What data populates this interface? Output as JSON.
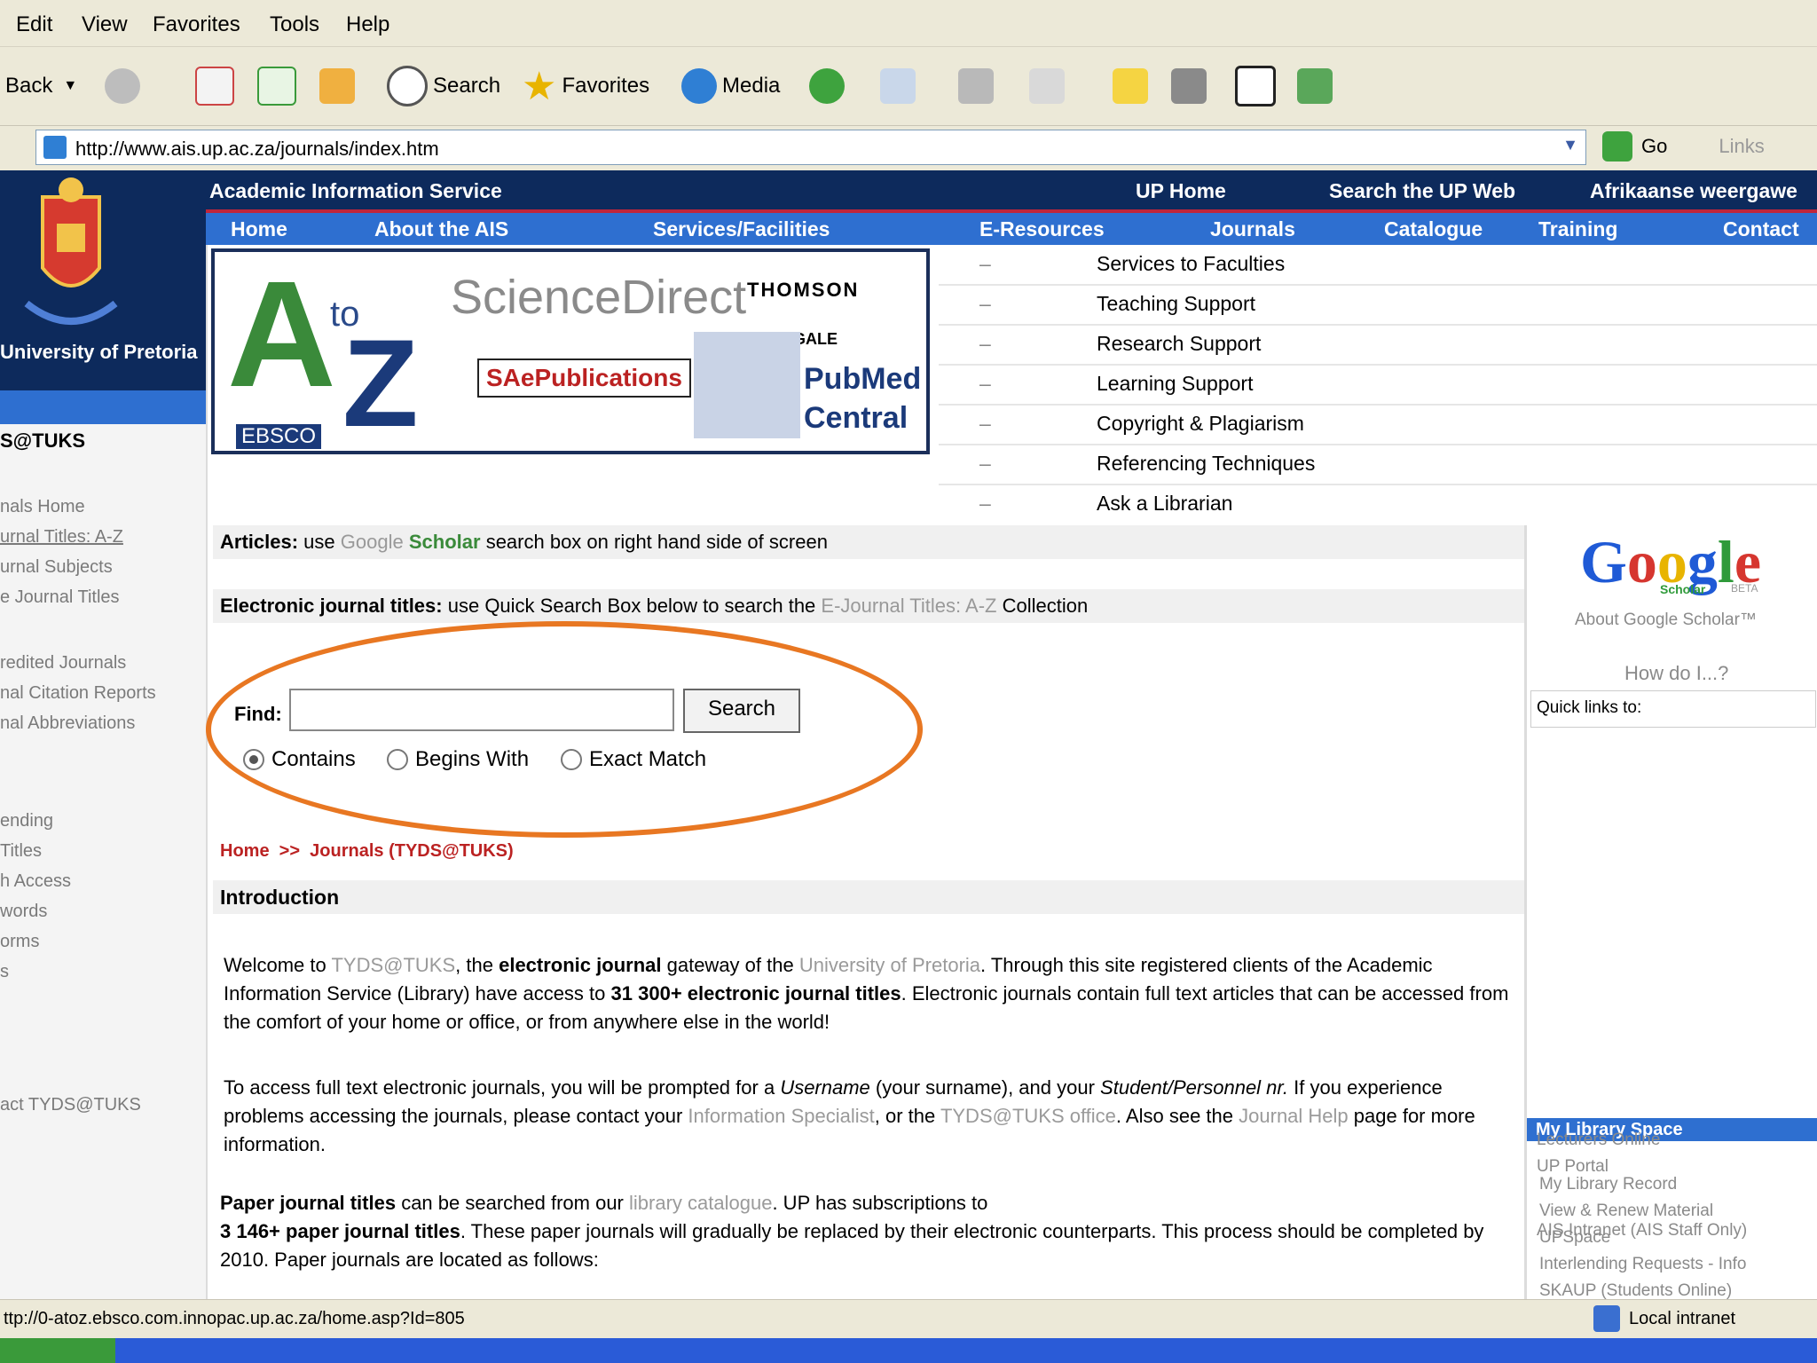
{
  "menu": {
    "items": [
      "Edit",
      "View",
      "Favorites",
      "Tools",
      "Help"
    ]
  },
  "toolbar": {
    "back": "Back",
    "search": "Search",
    "favorites": "Favorites",
    "media": "Media"
  },
  "address": {
    "url": "http://www.ais.up.ac.za/journals/index.htm",
    "go": "Go",
    "links": "Links"
  },
  "header": {
    "title": "Academic Information Service",
    "links": [
      "UP Home",
      "Search the UP Web",
      "Afrikaanse weergawe"
    ],
    "university": "University of Pretoria"
  },
  "nav": {
    "items": [
      "Home",
      "About the AIS",
      "Services/Facilities",
      "E-Resources",
      "Journals",
      "Catalogue",
      "Training",
      "Contact"
    ]
  },
  "banner": {
    "sciencedirect": "ScienceDirect",
    "thomson": "THOMSON",
    "gale": "GALE",
    "sae": "SAePublications",
    "pubmed1": "PubMed",
    "pubmed2": "Central",
    "ebsco": "EBSCO",
    "atoz_a": "A",
    "atoz_to": "to",
    "atoz_z": "Z"
  },
  "services": [
    "Services to Faculties",
    "Teaching Support",
    "Research Support",
    "Learning Support",
    "Copyright & Plagiarism",
    "Referencing Techniques",
    "Ask a Librarian"
  ],
  "sidebar": {
    "title": "S@TUKS",
    "links": [
      "nals Home",
      "urnal Titles: A-Z",
      "urnal Subjects",
      "e Journal Titles",
      "redited Journals",
      "nal Citation Reports",
      "nal Abbreviations",
      "ending",
      "Titles",
      "h Access",
      "words",
      "orms",
      "s",
      "act TYDS@TUKS"
    ]
  },
  "content": {
    "articles_label": "Articles:",
    "articles_text1": "use",
    "articles_google": "Google",
    "articles_scholar": "Scholar",
    "articles_text2": "search box on right hand side of screen",
    "ej_label": "Electronic journal titles:",
    "ej_text1": "use Quick Search Box below to search the",
    "ej_link": "E-Journal Titles: A-Z",
    "ej_text2": "Collection",
    "find_label": "Find:",
    "find_value": "",
    "search_button": "Search",
    "radio_options": [
      "Contains",
      "Begins With",
      "Exact Match"
    ],
    "radio_selected": "Contains",
    "breadcrumb": "Home  >>  Journals (TYDS@TUKS)",
    "intro_heading": "Introduction",
    "p1_a": "Welcome to",
    "p1_link1": "TYDS@TUKS",
    "p1_b": ", the",
    "p1_bold1": "electronic journal",
    "p1_c": "gateway of the",
    "p1_link2": "University of Pretoria",
    "p1_d": ". Through this site registered clients of the Academic Information Service (Library) have access to",
    "p1_bold2": "31 300+ electronic journal titles",
    "p1_e": ". Electronic journals contain full text articles that can be accessed from the comfort of your home or office, or from anywhere else in the world!",
    "p2_a": "To access full text electronic journals, you will be prompted for a",
    "p2_i1": "Username",
    "p2_b": "(your surname), and your",
    "p2_i2": "Student/Personnel nr.",
    "p2_c": "If you experience problems accessing the journals, please contact your",
    "p2_link1": "Information Specialist",
    "p2_d": ", or the",
    "p2_link2": "TYDS@TUKS office",
    "p2_e": ". Also see the",
    "p2_link3": "Journal Help",
    "p2_f": "page for more information.",
    "p3_bold1": "Paper journal titles",
    "p3_a": "can be searched from our",
    "p3_link": "library catalogue",
    "p3_b": ". UP has subscriptions to",
    "p3_bold2": "3 146+ paper journal titles",
    "p3_c": ". These paper journals will gradually be replaced by their electronic counterparts. This process should be completed by 2010. Paper journals are located as follows:"
  },
  "right": {
    "google": "Google",
    "scholar": "Scholar",
    "beta": "BETA",
    "about": "About Google Scholar™",
    "howdoi": "How do I...?",
    "quicklinks": "Quick links to:",
    "mylib_title": "My Library Space",
    "mylib_links": [
      "My Library Record",
      "View & Renew Material",
      "UPSpace",
      "Interlending Requests - Info",
      "SKAUP (Students Online)",
      "Lecturers Online",
      "UP Portal"
    ],
    "intranet": "AIS Intranet (AIS Staff Only)"
  },
  "status": {
    "url": "ttp://0-atoz.ebsco.com.innopac.up.ac.za/home.asp?Id=805",
    "zone": "Local intranet"
  },
  "colors": {
    "navy": "#0d2a5c",
    "nav_blue": "#2e6fd0",
    "accent_red": "#c0253a",
    "highlight_oval": "#e87722"
  }
}
